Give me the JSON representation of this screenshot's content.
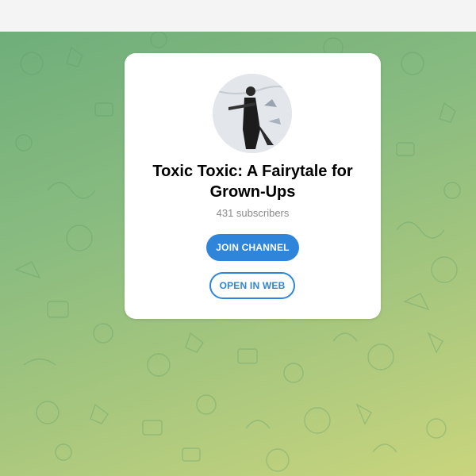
{
  "channel": {
    "title": "Toxic Toxic: A Fairytale for Grown-Ups",
    "subscribers": "431 subscribers"
  },
  "actions": {
    "join_label": "JOIN CHANNEL",
    "open_web_label": "OPEN IN WEB"
  },
  "colors": {
    "accent": "#2e85d9",
    "background_top": "#6fae7a",
    "background_bottom": "#c9d57d",
    "card": "#ffffff"
  }
}
